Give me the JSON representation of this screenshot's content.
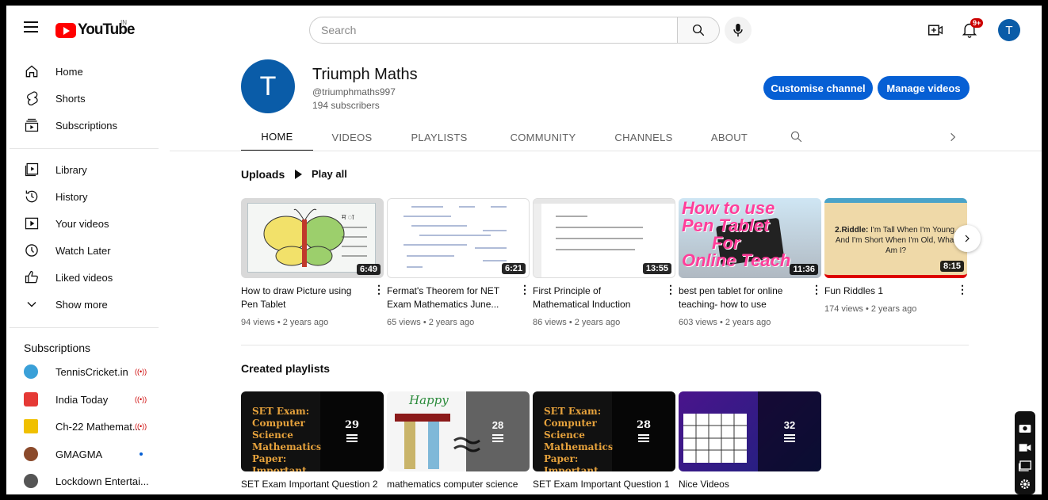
{
  "topbar": {
    "logo_text": "YouTube",
    "country": "IN",
    "search_placeholder": "Search",
    "notif_count": "9+",
    "avatar_letter": "T"
  },
  "sidebar": {
    "main": [
      {
        "label": "Home",
        "icon": "home-icon"
      },
      {
        "label": "Shorts",
        "icon": "shorts-icon"
      },
      {
        "label": "Subscriptions",
        "icon": "subscriptions-icon"
      }
    ],
    "library": [
      {
        "label": "Library",
        "icon": "library-icon"
      },
      {
        "label": "History",
        "icon": "history-icon"
      },
      {
        "label": "Your videos",
        "icon": "your-videos-icon"
      },
      {
        "label": "Watch Later",
        "icon": "watch-later-icon"
      },
      {
        "label": "Liked videos",
        "icon": "liked-icon"
      },
      {
        "label": "Show more",
        "icon": "chevron-down-icon"
      }
    ],
    "subs_heading": "Subscriptions",
    "subs": [
      {
        "label": "TennisCricket.in",
        "color": "#3aa0d8",
        "live": true
      },
      {
        "label": "India Today",
        "color": "#e53935",
        "live": true
      },
      {
        "label": "Ch-22 Mathemat...",
        "color": "#f0c000",
        "live": true
      },
      {
        "label": "GMAGMA",
        "color": "#8b4a2b",
        "live": false
      },
      {
        "label": "Lockdown Entertai...",
        "color": "#555555",
        "live": false
      }
    ]
  },
  "channel": {
    "avatar_letter": "T",
    "name": "Triumph Maths",
    "handle": "@triumphmaths997",
    "subscribers": "194 subscribers",
    "customise_label": "Customise channel",
    "manage_label": "Manage videos"
  },
  "tabs": [
    "HOME",
    "VIDEOS",
    "PLAYLISTS",
    "COMMUNITY",
    "CHANNELS",
    "ABOUT"
  ],
  "uploads": {
    "title": "Uploads",
    "play_all": "Play all",
    "videos": [
      {
        "title": "How to draw Picture using Pen Tablet",
        "meta": "94 views • 2 years ago",
        "duration": "6:49"
      },
      {
        "title": "Fermat's Theorem for NET Exam Mathematics June...",
        "meta": "65 views • 2 years ago",
        "duration": "6:21"
      },
      {
        "title": "First Principle of Mathematical Induction",
        "meta": "86 views • 2 years ago",
        "duration": "13:55"
      },
      {
        "title": "best pen tablet for online teaching- how to use",
        "meta": "603 views • 2 years ago",
        "duration": "11:36"
      },
      {
        "title": "Fun Riddles 1",
        "meta": "174 views • 2 years ago",
        "duration": "8:15"
      }
    ],
    "thumb_text": {
      "pen_line1": "How to use",
      "pen_line2": "Pen Tablet",
      "pen_line3": "For",
      "pen_line4": "Online Teach",
      "riddle_bold": "2.Riddle:",
      "riddle_text": " I'm Tall When I'm Young, And I'm Short When I'm Old, What Am I?"
    }
  },
  "playlists": {
    "title": "Created playlists",
    "items": [
      {
        "title": "SET Exam Important Question 2",
        "count": "29"
      },
      {
        "title": "mathematics computer science",
        "count": "28"
      },
      {
        "title": "SET Exam Important Question 1",
        "count": "28"
      },
      {
        "title": "Nice Videos",
        "count": "32"
      }
    ],
    "set_thumb": "SET Exam: Computer Science Mathematics Paper: Important Question",
    "happy_text": "Happy"
  }
}
